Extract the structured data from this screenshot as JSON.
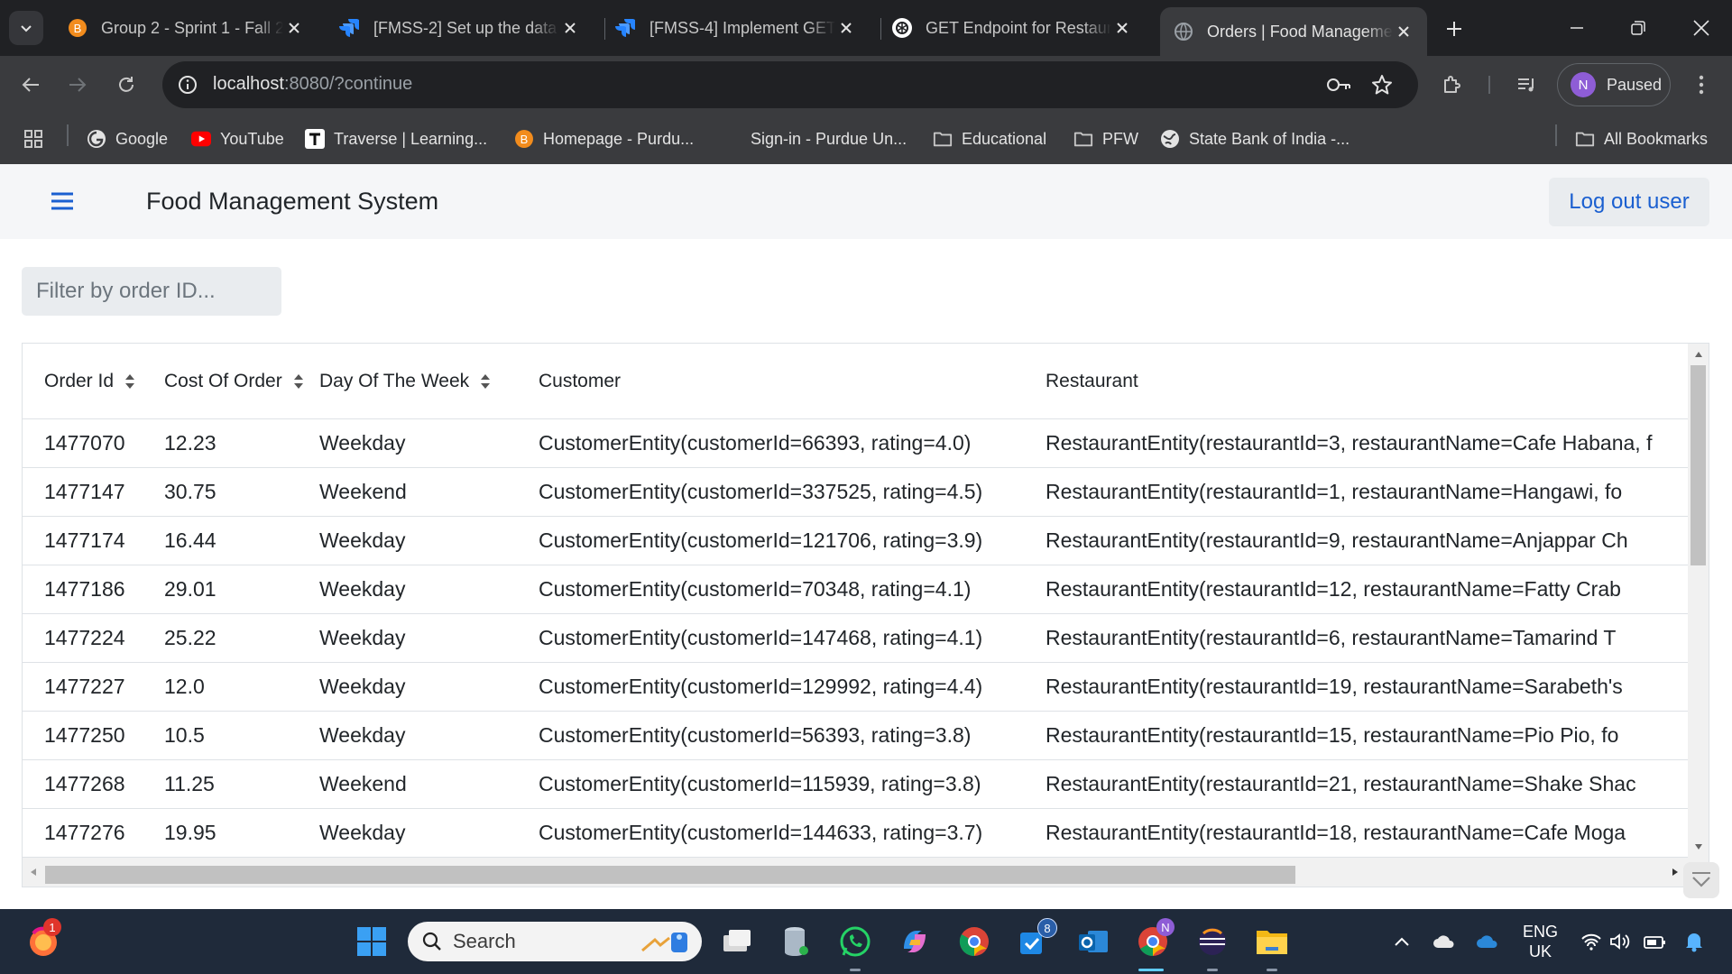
{
  "browser": {
    "tabs": [
      {
        "title": "Group 2 - Sprint 1 - Fall 2",
        "icon": "brightspace-icon",
        "active": false
      },
      {
        "title": "[FMSS-2] Set up the data",
        "icon": "jira-icon",
        "active": false
      },
      {
        "title": "[FMSS-4] Implement GET",
        "icon": "jira-icon",
        "active": false
      },
      {
        "title": "GET Endpoint for Restaur",
        "icon": "chatgpt-icon",
        "active": false
      },
      {
        "title": "Orders | Food Manageme",
        "icon": "globe-icon",
        "active": true
      }
    ],
    "address": {
      "host": "localhost",
      "rest": ":8080/?continue"
    },
    "profile": {
      "initial": "N",
      "label": "Paused"
    },
    "bookmarks": [
      {
        "label": "Google",
        "icon": "google-icon"
      },
      {
        "label": "YouTube",
        "icon": "youtube-icon"
      },
      {
        "label": "Traverse | Learning...",
        "icon": "traverse-icon"
      },
      {
        "label": "Homepage - Purdu...",
        "icon": "brightspace-icon"
      },
      {
        "label": "Sign-in - Purdue Un...",
        "icon": "blank-icon"
      },
      {
        "label": "Educational",
        "icon": "folder-icon"
      },
      {
        "label": "PFW",
        "icon": "folder-icon"
      },
      {
        "label": "State Bank of India -...",
        "icon": "globe-icon"
      }
    ],
    "all_bookmarks": "All Bookmarks"
  },
  "app": {
    "title": "Food Management System",
    "logout_label": "Log out user",
    "filter_placeholder": "Filter by order ID..."
  },
  "table": {
    "columns": [
      "Order Id",
      "Cost Of Order",
      "Day Of The Week",
      "Customer",
      "Restaurant"
    ],
    "rows": [
      {
        "order_id": "1477070",
        "cost": "12.23",
        "day": "Weekday",
        "customer": "CustomerEntity(customerId=66393, rating=4.0)",
        "restaurant": "RestaurantEntity(restaurantId=3, restaurantName=Cafe Habana, f"
      },
      {
        "order_id": "1477147",
        "cost": "30.75",
        "day": "Weekend",
        "customer": "CustomerEntity(customerId=337525, rating=4.5)",
        "restaurant": "RestaurantEntity(restaurantId=1, restaurantName=Hangawi, fo"
      },
      {
        "order_id": "1477174",
        "cost": "16.44",
        "day": "Weekday",
        "customer": "CustomerEntity(customerId=121706, rating=3.9)",
        "restaurant": "RestaurantEntity(restaurantId=9, restaurantName=Anjappar Ch"
      },
      {
        "order_id": "1477186",
        "cost": "29.01",
        "day": "Weekday",
        "customer": "CustomerEntity(customerId=70348, rating=4.1)",
        "restaurant": "RestaurantEntity(restaurantId=12, restaurantName=Fatty Crab"
      },
      {
        "order_id": "1477224",
        "cost": "25.22",
        "day": "Weekday",
        "customer": "CustomerEntity(customerId=147468, rating=4.1)",
        "restaurant": "RestaurantEntity(restaurantId=6, restaurantName=Tamarind T"
      },
      {
        "order_id": "1477227",
        "cost": "12.0",
        "day": "Weekday",
        "customer": "CustomerEntity(customerId=129992, rating=4.4)",
        "restaurant": "RestaurantEntity(restaurantId=19, restaurantName=Sarabeth's"
      },
      {
        "order_id": "1477250",
        "cost": "10.5",
        "day": "Weekday",
        "customer": "CustomerEntity(customerId=56393, rating=3.8)",
        "restaurant": "RestaurantEntity(restaurantId=15, restaurantName=Pio Pio, fo"
      },
      {
        "order_id": "1477268",
        "cost": "11.25",
        "day": "Weekend",
        "customer": "CustomerEntity(customerId=115939, rating=3.8)",
        "restaurant": "RestaurantEntity(restaurantId=21, restaurantName=Shake Shac"
      },
      {
        "order_id": "1477276",
        "cost": "19.95",
        "day": "Weekday",
        "customer": "CustomerEntity(customerId=144633, rating=3.7)",
        "restaurant": "RestaurantEntity(restaurantId=18, restaurantName=Cafe Moga"
      }
    ]
  },
  "taskbar": {
    "search_label": "Search",
    "language": {
      "top": "ENG",
      "bottom": "UK"
    },
    "badges": {
      "firefox": "1",
      "todo": "8",
      "chrome": "N"
    }
  }
}
